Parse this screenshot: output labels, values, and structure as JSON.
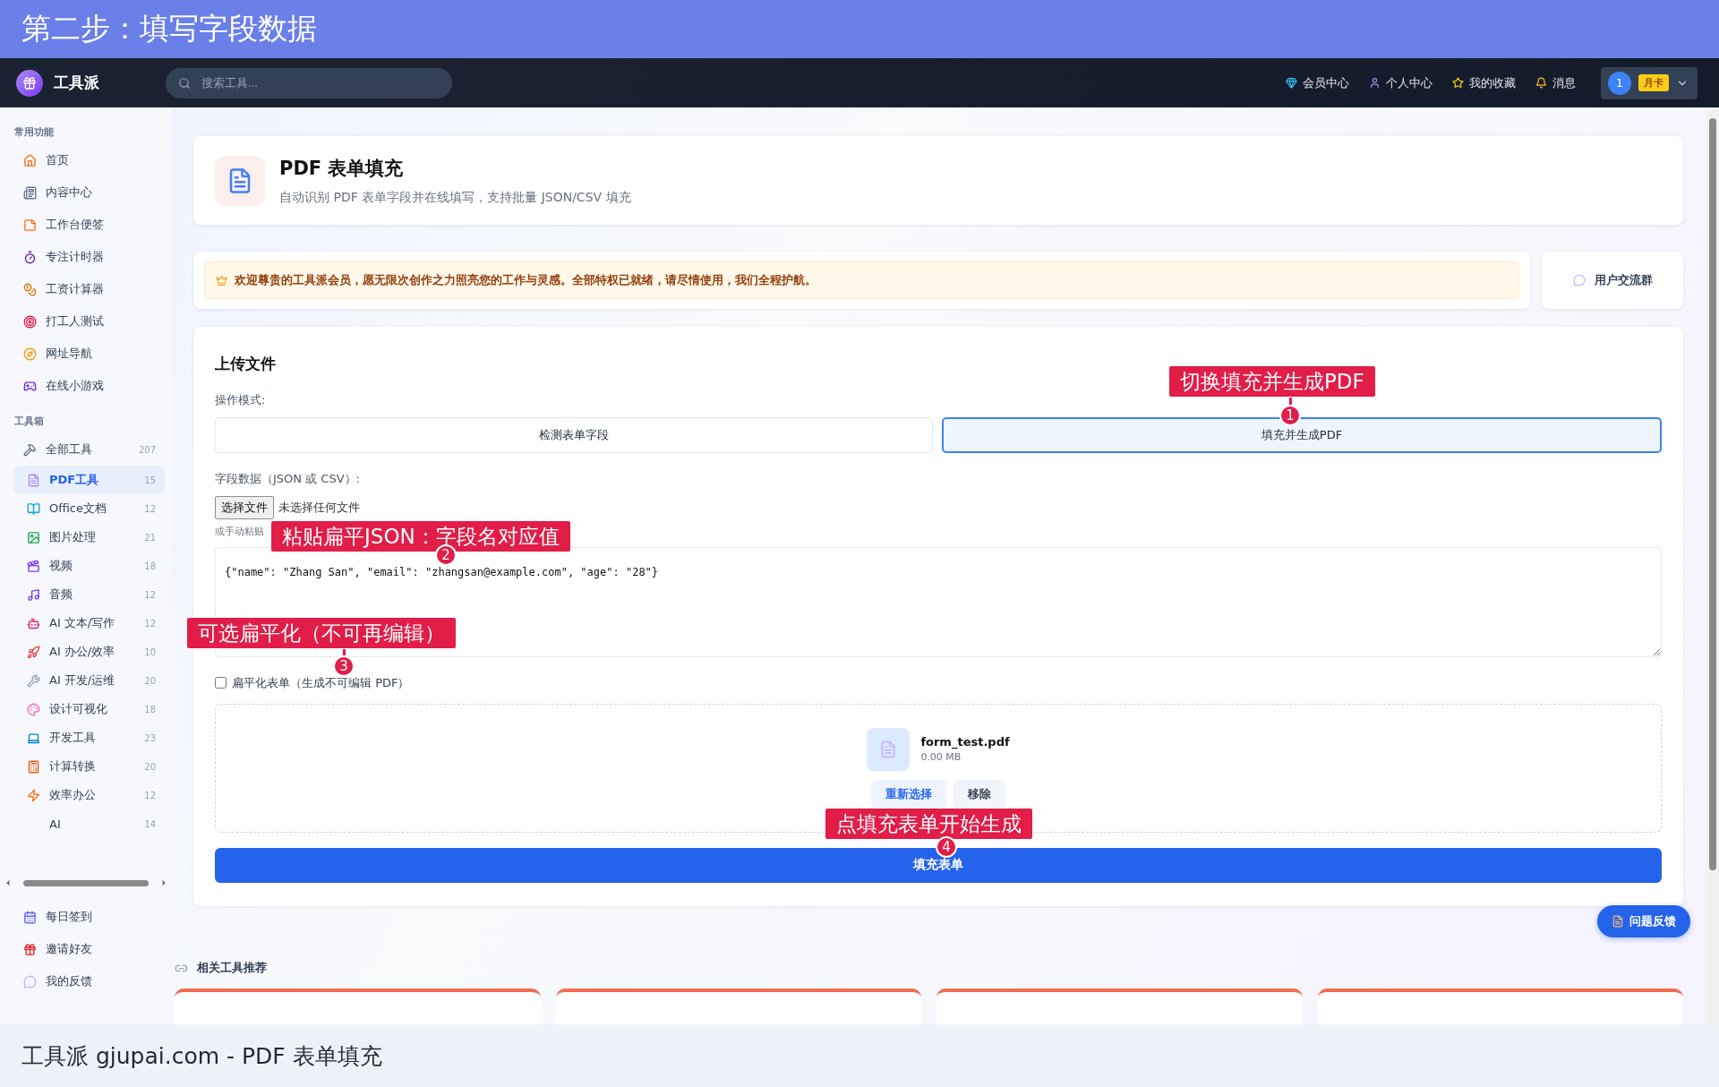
{
  "banner": {
    "title": "第二步：填写字段数据"
  },
  "navbar": {
    "brand": "工具派",
    "search": {
      "placeholder": "搜索工具..."
    },
    "links": [
      {
        "label": "会员中心",
        "kind": "gem"
      },
      {
        "label": "个人中心",
        "kind": "user"
      },
      {
        "label": "我的收藏",
        "kind": "star"
      },
      {
        "label": "消息",
        "kind": "bell"
      }
    ],
    "user": {
      "avatar": "1",
      "badge": "月卡"
    }
  },
  "sidebar": {
    "sections": [
      {
        "title": "常用功能",
        "items": [
          {
            "label": "首页",
            "kind": "home",
            "selected": false
          },
          {
            "label": "内容中心",
            "kind": "news",
            "selected": false
          },
          {
            "label": "工作台便签",
            "kind": "note",
            "selected": false
          },
          {
            "label": "专注计时器",
            "kind": "timer",
            "selected": false
          },
          {
            "label": "工资计算器",
            "kind": "coins",
            "selected": false
          },
          {
            "label": "打工人测试",
            "kind": "target",
            "selected": false
          },
          {
            "label": "网址导航",
            "kind": "compass",
            "selected": false
          },
          {
            "label": "在线小游戏",
            "kind": "game",
            "selected": false
          }
        ]
      },
      {
        "title": "工具箱",
        "items": [
          {
            "label": "全部工具",
            "kind": "tools",
            "count": "207",
            "selected": false,
            "children": [
              {
                "label": "PDF工具",
                "kind": "pdf",
                "count": "15",
                "selected": true
              },
              {
                "label": "Office文档",
                "kind": "book",
                "count": "12",
                "selected": false
              },
              {
                "label": "图片处理",
                "kind": "image",
                "count": "21",
                "selected": false
              },
              {
                "label": "视频",
                "kind": "video",
                "count": "18",
                "selected": false
              },
              {
                "label": "音频",
                "kind": "music",
                "count": "12",
                "selected": false
              },
              {
                "label": "AI 文本/写作",
                "kind": "bot",
                "count": "12",
                "selected": false
              },
              {
                "label": "AI 办公/效率",
                "kind": "rocket",
                "count": "10",
                "selected": false
              },
              {
                "label": "AI 开发/运维",
                "kind": "wrench",
                "count": "20",
                "selected": false
              },
              {
                "label": "设计可视化",
                "kind": "palette",
                "count": "18",
                "selected": false
              },
              {
                "label": "开发工具",
                "kind": "laptop",
                "count": "23",
                "selected": false
              },
              {
                "label": "计算转换",
                "kind": "calc",
                "count": "20",
                "selected": false
              },
              {
                "label": "效率办公",
                "kind": "zap",
                "count": "12",
                "selected": false
              },
              {
                "label": "AI",
                "kind": "none",
                "count": "14",
                "selected": false
              }
            ]
          }
        ]
      }
    ],
    "bottom_items": [
      {
        "label": "每日签到",
        "kind": "calendar"
      },
      {
        "label": "邀请好友",
        "kind": "gift"
      },
      {
        "label": "我的反馈",
        "kind": "chat"
      }
    ]
  },
  "page_header": {
    "title": "PDF 表单填充",
    "subtitle": "自动识别 PDF 表单字段并在线填写，支持批量 JSON/CSV 填充"
  },
  "notice": {
    "text": "欢迎尊贵的工具派会员，愿无限次创作之力照亮您的工作与灵感。全部特权已就绪，请尽情使用，我们全程护航。",
    "group_button": "用户交流群"
  },
  "form": {
    "title": "上传文件",
    "mode_label": "操作模式:",
    "modes": [
      {
        "label": "检测表单字段",
        "selected": false
      },
      {
        "label": "填充并生成PDF",
        "selected": true
      }
    ],
    "data_label": "字段数据（JSON 或 CSV）:",
    "file_button": "选择文件",
    "file_status": "未选择任何文件",
    "paste_hint": "或手动粘贴",
    "textarea_value": "{\"name\": \"Zhang San\", \"email\": \"zhangsan@example.com\", \"age\": \"28\"}",
    "flatten": {
      "label": "扁平化表单（生成不可编辑 PDF）",
      "checked": false
    },
    "file": {
      "name": "form_test.pdf",
      "size": "0.00 MB",
      "actions": [
        "重新选择",
        "移除"
      ]
    },
    "submit": "填充表单"
  },
  "related": {
    "title": "相关工具推荐",
    "cards": [
      {
        "kind": "tool-card"
      },
      {
        "kind": "tool-card"
      },
      {
        "kind": "tool-card"
      },
      {
        "kind": "tool-card"
      }
    ]
  },
  "feedback_button": "问题反馈",
  "callouts": [
    {
      "number": "1",
      "text": "切换填充并生成PDF"
    },
    {
      "number": "2",
      "text": "粘贴扁平JSON：字段名对应值"
    },
    {
      "number": "3",
      "text": "可选扁平化（不可再编辑）"
    },
    {
      "number": "4",
      "text": "点填充表单开始生成"
    }
  ],
  "caption": "工具派 gjupai.com - PDF 表单填充"
}
